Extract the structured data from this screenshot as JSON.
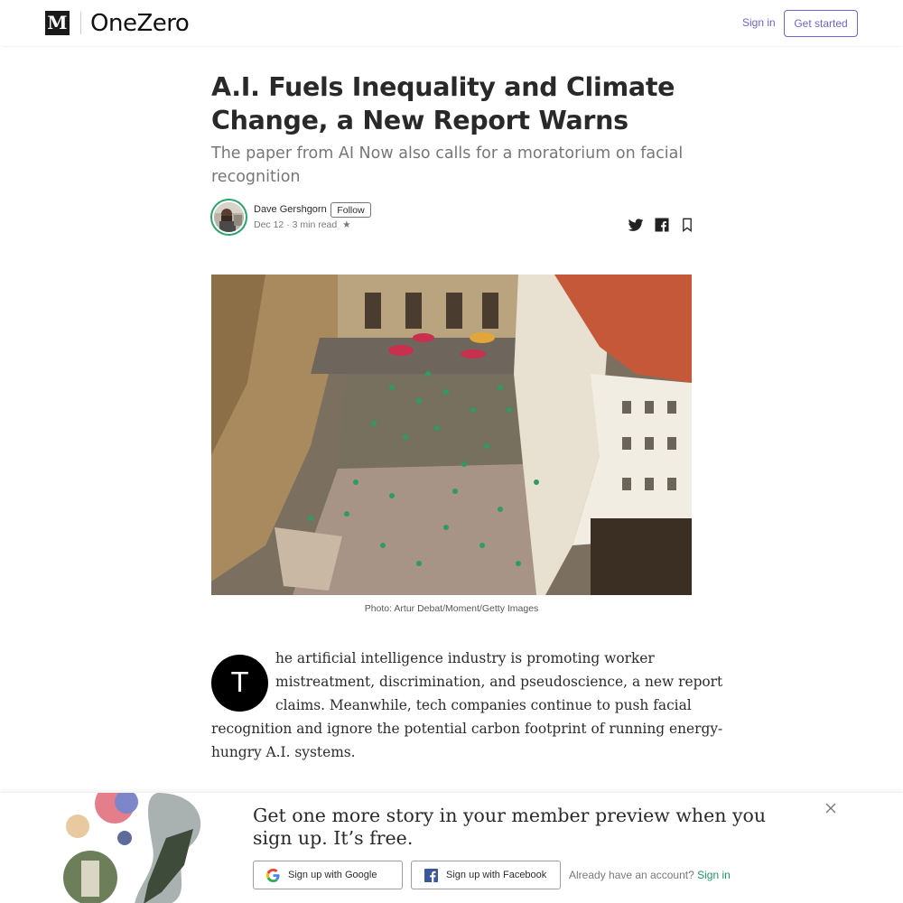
{
  "header": {
    "logo_letter": "M",
    "publication": "OneZero",
    "sign_in": "Sign in",
    "get_started": "Get started"
  },
  "article": {
    "title_line1": "A.I. Fuels Inequality and Climate",
    "title_line2": "Change, a New Report Warns",
    "subtitle": "The paper from AI Now also calls for a moratorium on facial recognition",
    "author": "Dave Gershgorn",
    "follow": "Follow",
    "date": "Dec 12",
    "separator": "·",
    "read_time": "3 min read",
    "star": "★",
    "caption": "Photo: Artur Debat/Moment/Getty Images",
    "dropcap": "T",
    "body_lines": [
      "he artificial intelligence industry is promoting worker",
      "mistreatment, discrimination, and pseudoscience, a new report",
      "claims. Meanwhile, tech companies continue to push facial",
      "recognition and ignore the potential carbon footprint of running energy-",
      "hungry A.I. systems."
    ]
  },
  "share": {
    "icons": [
      "twitter-icon",
      "facebook-icon",
      "bookmark-icon"
    ]
  },
  "banner": {
    "headline": "Get one more story in your member preview when you sign up. It’s free.",
    "google": "Sign up with Google",
    "facebook": "Sign up with Facebook",
    "have_account": "Already have an account?",
    "sign_in": "Sign in"
  },
  "colors": {
    "accent": "#6b66c9",
    "green": "#1c9963"
  }
}
